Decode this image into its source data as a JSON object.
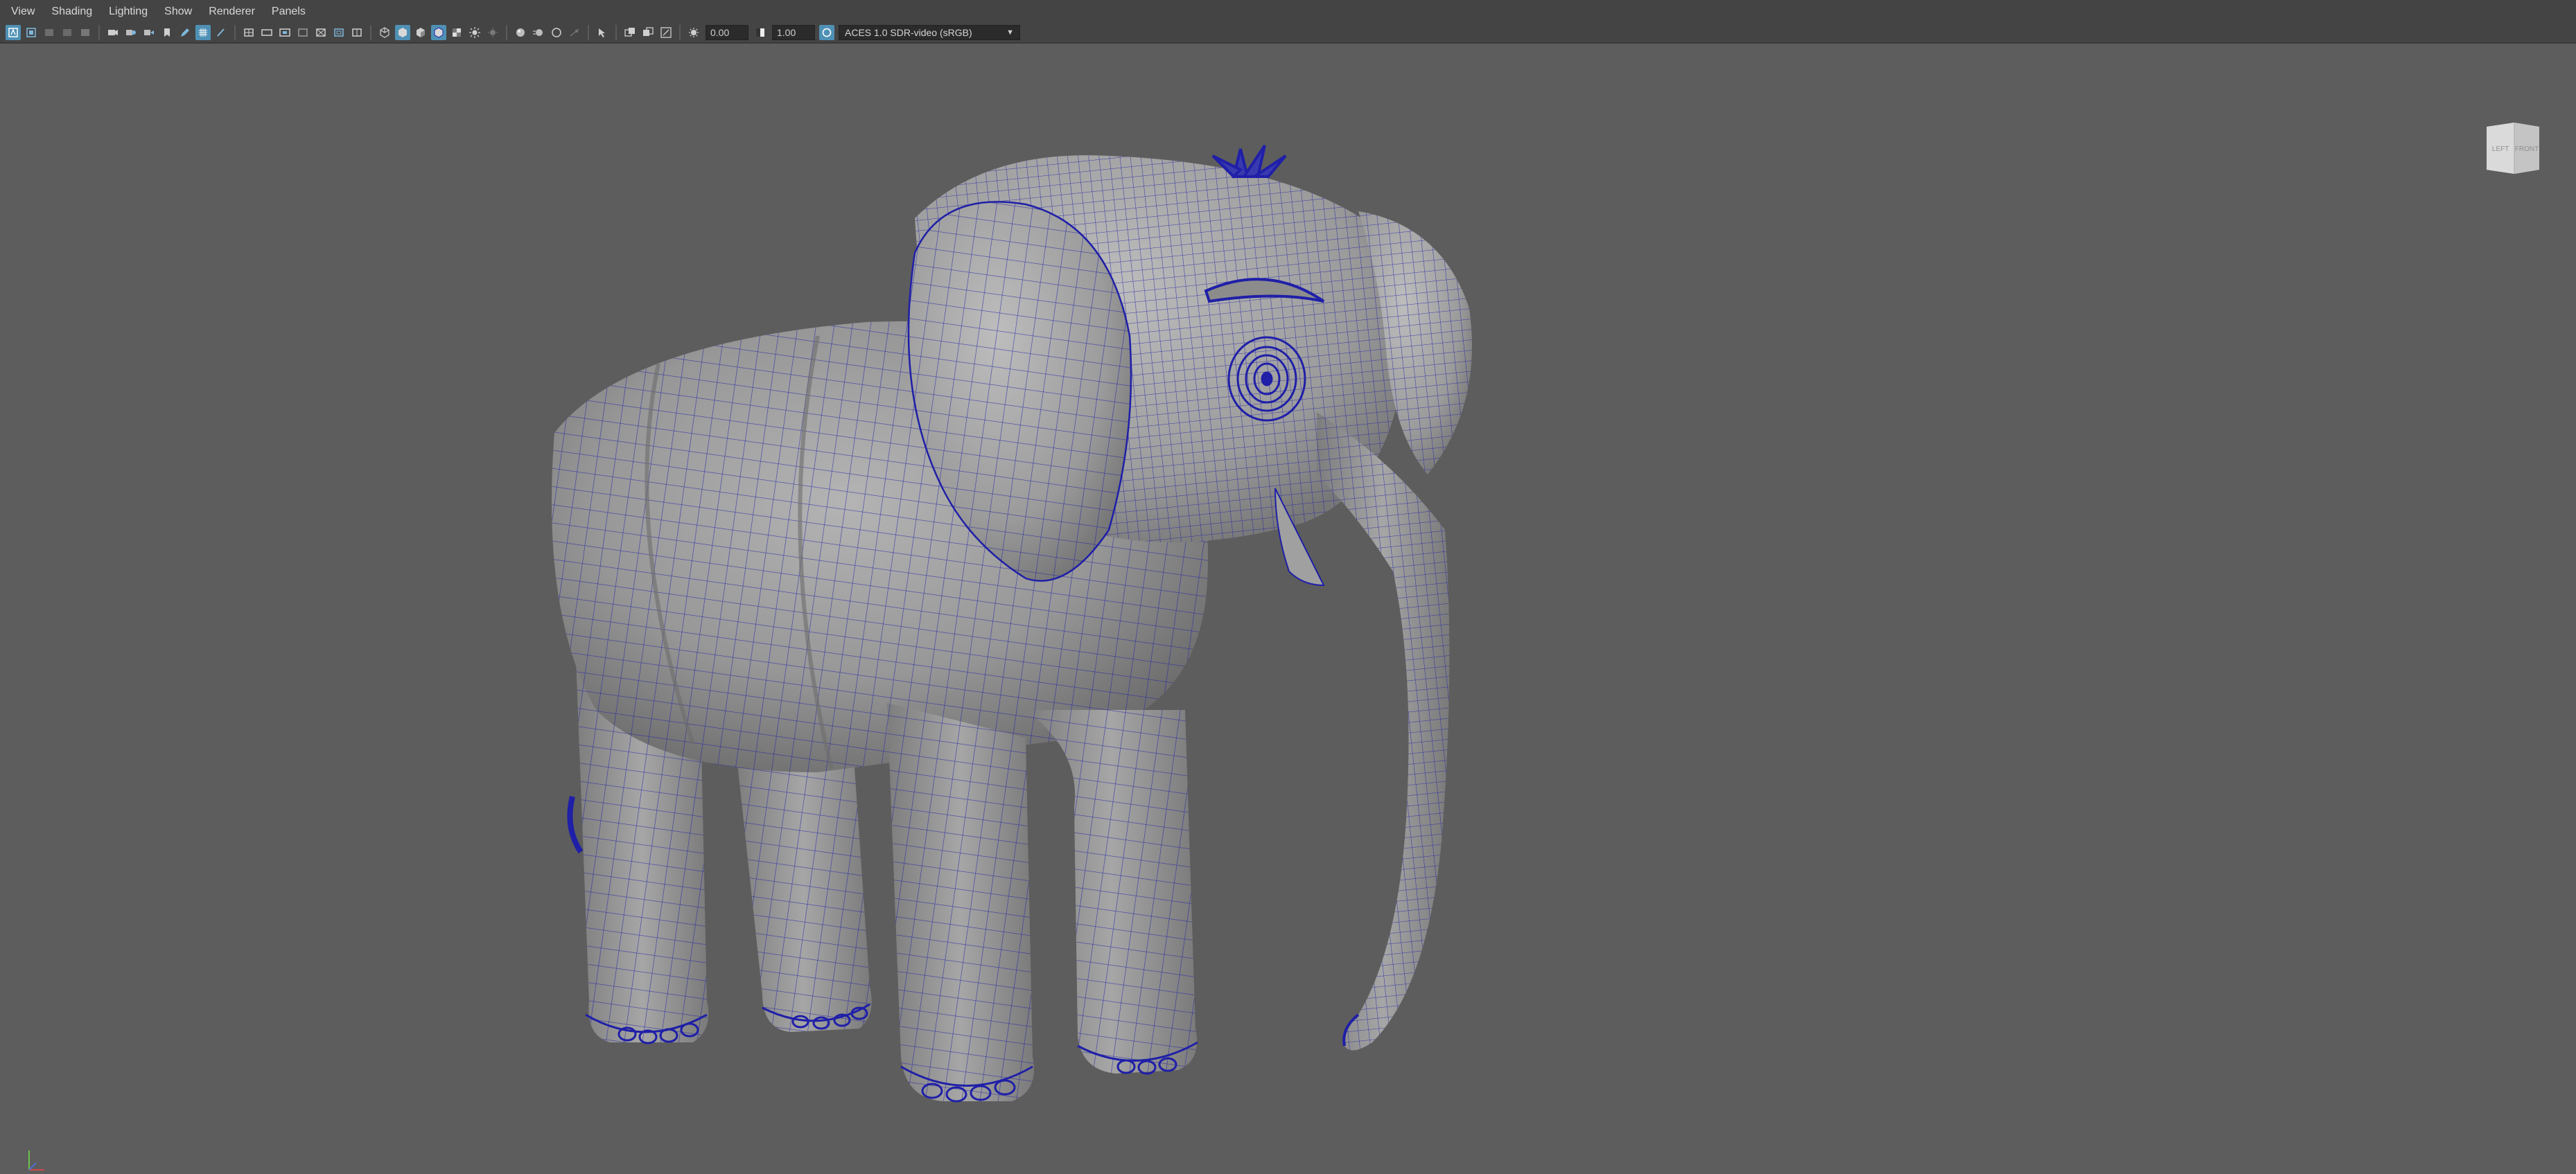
{
  "menu": [
    "View",
    "Shading",
    "Lighting",
    "Show",
    "Renderer",
    "Panels"
  ],
  "toolbar": {
    "exposure_value": "0.00",
    "gamma_value": "1.00",
    "color_management": "ACES 1.0 SDR-video (sRGB)",
    "icons": [
      "select-camera-icon",
      "lock-camera-icon",
      "camera-attributes-icon",
      "bookmark-icon",
      "image-plane-icon",
      "grid-icon",
      "film-gate-icon",
      "resolution-gate-icon",
      "gate-mask-icon",
      "field-chart-icon",
      "safe-action-icon",
      "safe-title-icon",
      "wireframe-icon",
      "smooth-shade-icon",
      "use-default-material-icon",
      "wireframe-on-shaded-icon",
      "textured-icon",
      "use-all-lights-icon",
      "shadows-icon",
      "screen-space-ao-icon",
      "motion-blur-icon",
      "anti-aliasing-icon",
      "depth-of-field-icon",
      "isolate-select-icon",
      "xray-icon",
      "xray-joints-icon",
      "xray-components-icon"
    ]
  },
  "viewcube": {
    "left_face": "LEFT",
    "front_face": "FRONT"
  },
  "colors": {
    "viewport_bg": "#5d5d5d",
    "toolbar_bg": "#444444",
    "wireframe": "#1f1fa8",
    "mesh_shade": "#9a9a9a",
    "active_icon": "#4f91b5"
  }
}
